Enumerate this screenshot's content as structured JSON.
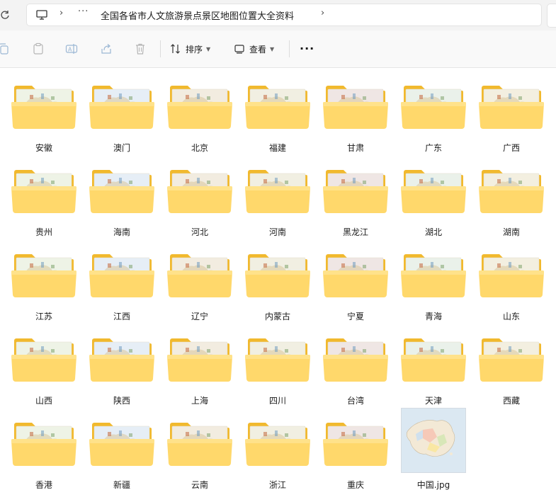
{
  "address_bar": {
    "breadcrumb": "全国各省市人文旅游景点景区地图位置大全资料",
    "overflow_label": "···"
  },
  "toolbar": {
    "sort_label": "排序",
    "view_label": "查看",
    "more_label": "···"
  },
  "colors": {
    "folder_back": "#f1b92e",
    "folder_front": "#ffd86b",
    "paper": "#f4f0e4"
  },
  "items": [
    {
      "name": "安徽",
      "type": "folder"
    },
    {
      "name": "澳门",
      "type": "folder"
    },
    {
      "name": "北京",
      "type": "folder"
    },
    {
      "name": "福建",
      "type": "folder"
    },
    {
      "name": "甘肃",
      "type": "folder"
    },
    {
      "name": "广东",
      "type": "folder"
    },
    {
      "name": "广西",
      "type": "folder"
    },
    {
      "name": "贵州",
      "type": "folder"
    },
    {
      "name": "海南",
      "type": "folder"
    },
    {
      "name": "河北",
      "type": "folder"
    },
    {
      "name": "河南",
      "type": "folder"
    },
    {
      "name": "黑龙江",
      "type": "folder"
    },
    {
      "name": "湖北",
      "type": "folder"
    },
    {
      "name": "湖南",
      "type": "folder"
    },
    {
      "name": "江苏",
      "type": "folder"
    },
    {
      "name": "江西",
      "type": "folder"
    },
    {
      "name": "辽宁",
      "type": "folder"
    },
    {
      "name": "内蒙古",
      "type": "folder"
    },
    {
      "name": "宁夏",
      "type": "folder"
    },
    {
      "name": "青海",
      "type": "folder"
    },
    {
      "name": "山东",
      "type": "folder"
    },
    {
      "name": "山西",
      "type": "folder"
    },
    {
      "name": "陕西",
      "type": "folder"
    },
    {
      "name": "上海",
      "type": "folder"
    },
    {
      "name": "四川",
      "type": "folder"
    },
    {
      "name": "台湾",
      "type": "folder"
    },
    {
      "name": "天津",
      "type": "folder"
    },
    {
      "name": "西藏",
      "type": "folder"
    },
    {
      "name": "香港",
      "type": "folder"
    },
    {
      "name": "新疆",
      "type": "folder"
    },
    {
      "name": "云南",
      "type": "folder"
    },
    {
      "name": "浙江",
      "type": "folder"
    },
    {
      "name": "重庆",
      "type": "folder"
    },
    {
      "name": "中国.jpg",
      "type": "image"
    }
  ]
}
